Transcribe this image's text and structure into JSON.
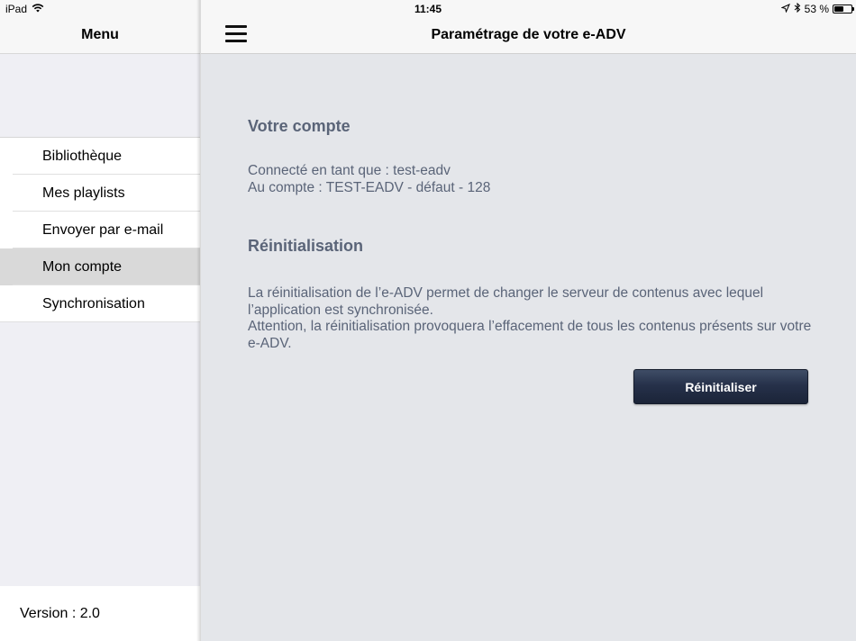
{
  "statusbar": {
    "device": "iPad",
    "time": "11:45",
    "battery": "53 %",
    "battery_level": 0.53
  },
  "sidebar": {
    "title": "Menu",
    "items": [
      {
        "label": "Bibliothèque"
      },
      {
        "label": "Mes playlists"
      },
      {
        "label": "Envoyer par e-mail"
      },
      {
        "label": "Mon compte",
        "selected": true
      },
      {
        "label": "Synchronisation"
      }
    ],
    "version": "Version : 2.0"
  },
  "main": {
    "title": "Paramétrage de votre e-ADV",
    "account": {
      "heading": "Votre compte",
      "line1": "Connecté en tant que : test-eadv",
      "line2": "Au compte : TEST-EADV - défaut - 128"
    },
    "reset": {
      "heading": "Réinitialisation",
      "paragraph1": "La réinitialisation de l’e-ADV permet de changer le serveur de contenus avec lequel l’application est synchronisée.",
      "paragraph2": "Attention, la réinitialisation provoquera l’effacement de tous les contenus présents sur votre e-ADV.",
      "button_label": "Réinitialiser"
    }
  },
  "colors": {
    "accent_button": "#26314a",
    "text_muted": "#5a6478",
    "selected_row": "#d9d9d9"
  }
}
